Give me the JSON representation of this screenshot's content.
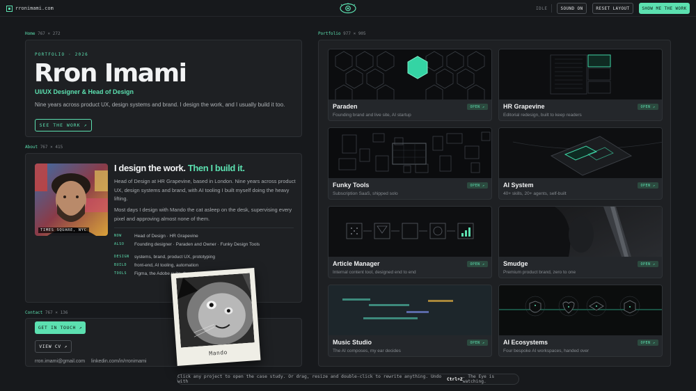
{
  "topbar": {
    "site_name": "rronimami.com",
    "status": "IDLE",
    "sound_label": "SOUND ON",
    "reset_label": "RESET LAYOUT",
    "cta_label": "SHOW ME THE WORK"
  },
  "home": {
    "label": "Home",
    "size": "767 × 272",
    "eyebrow": "PORTFOLIO · 2026",
    "name": "Rron Imami",
    "role": "UI/UX Designer & Head of Design",
    "intro": "Nine years across product UX, design systems and brand. I design the work, and I usually build it too.",
    "cta": "SEE THE WORK ↗"
  },
  "about": {
    "label": "About",
    "size": "767 × 415",
    "photo_caption": "TIMES SQUARE, NYC",
    "headline_a": "I design the work.",
    "headline_b": "Then I build it.",
    "para1": "Head of Design at HR Grapevine, based in London. Nine years across product UX, design systems and brand, with AI tooling I built myself doing the heavy lifting.",
    "para2": "Most days I design with Mando the cat asleep on the desk, supervising every pixel and approving almost none of them.",
    "facts": [
      {
        "key": "NOW",
        "value": "Head of Design · HR Grapevine"
      },
      {
        "key": "ALSO",
        "value": "Founding designer · Paraden and Owner · Funky Design Tools"
      },
      {
        "key": "DESIGN",
        "value": "systems, brand, product UX, prototyping"
      },
      {
        "key": "BUILD",
        "value": "front-end, AI tooling, automation"
      },
      {
        "key": "TOOLS",
        "value": "Figma, the Adobe suite, the odd"
      }
    ]
  },
  "contact": {
    "label": "Contact",
    "size": "767 × 136",
    "touch_label": "GET IN TOUCH ↗",
    "cv_label": "VIEW CV ↗",
    "email": "rron.imami@gmail.com",
    "linkedin": "linkedin.com/in/rronimami"
  },
  "polaroid": {
    "caption": "Mando"
  },
  "portfolio": {
    "label": "Portfolio",
    "size": "977 × 905",
    "open_label": "OPEN ↗",
    "projects": [
      {
        "title": "Paraden",
        "sub": "Founding brand and live site, AI startup"
      },
      {
        "title": "HR Grapevine",
        "sub": "Editorial redesign, built to keep readers"
      },
      {
        "title": "Funky Tools",
        "sub": "Subscription SaaS, shipped solo"
      },
      {
        "title": "AI System",
        "sub": "40+ skills, 20+ agents, self-built"
      },
      {
        "title": "Article Manager",
        "sub": "Internal content tool, designed end to end"
      },
      {
        "title": "Smudge",
        "sub": "Premium product brand, zero to one"
      },
      {
        "title": "Music Studio",
        "sub": "The AI composes, my ear decides"
      },
      {
        "title": "AI Ecosystems",
        "sub": "Four bespoke AI workspaces, handed over"
      }
    ]
  },
  "footer": {
    "text_a": "Click any project to open the case study. Or drag, resize and double-click to rewrite anything. Undo with",
    "shortcut": "Ctrl+Z",
    "text_b": ". The Eye is watching."
  },
  "colors": {
    "accent": "#5ce0b0",
    "background": "#17191c",
    "panel": "#1e2023"
  }
}
